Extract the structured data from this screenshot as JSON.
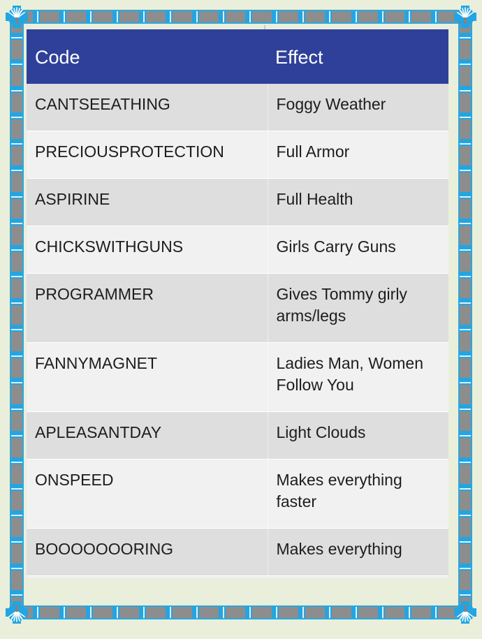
{
  "page": {
    "background_color": "#e9efdb",
    "frame_accent_color": "#22a5e2",
    "frame_dash_color": "#8d8d8d",
    "corner_ornament": "sparkler-burst"
  },
  "table": {
    "header_background": "#2f409a",
    "header_text_color": "#ffffff",
    "row_even_background": "#dededf",
    "row_odd_background": "#f1f1f1",
    "columns": [
      "Code",
      "Effect"
    ],
    "rows": [
      {
        "code": "CANTSEEATHING",
        "effect": "Foggy Weather"
      },
      {
        "code": "PRECIOUSPROTECTION",
        "effect": "Full Armor"
      },
      {
        "code": "ASPIRINE",
        "effect": "Full Health"
      },
      {
        "code": "CHICKSWITHGUNS",
        "effect": "Girls Carry Guns"
      },
      {
        "code": "PROGRAMMER",
        "effect": "Gives Tommy girly arms/legs"
      },
      {
        "code": "FANNYMAGNET",
        "effect": "Ladies Man, Women Follow You"
      },
      {
        "code": "APLEASANTDAY",
        "effect": "Light Clouds"
      },
      {
        "code": "ONSPEED",
        "effect": "Makes everything faster"
      },
      {
        "code": "BOOOOOOORING",
        "effect": "Makes everything"
      }
    ]
  }
}
